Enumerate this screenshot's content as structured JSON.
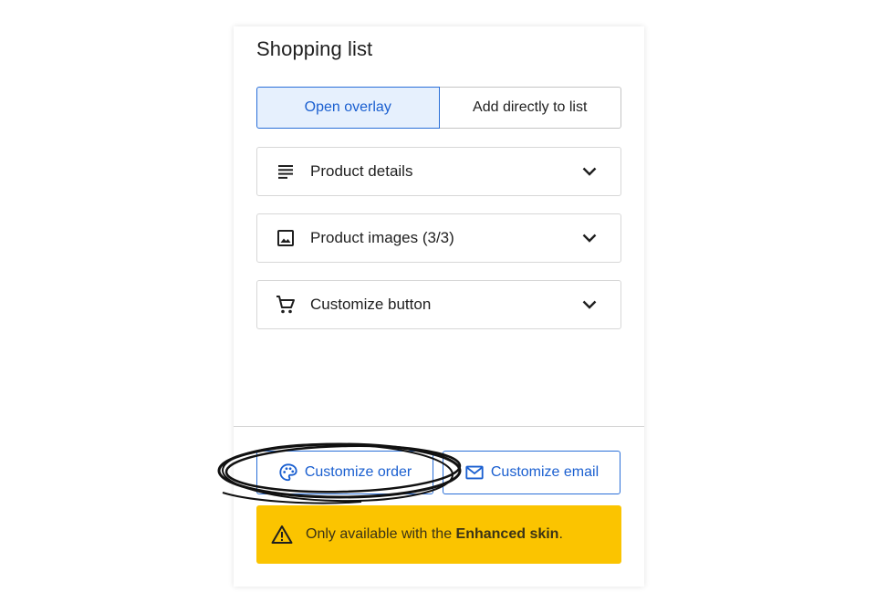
{
  "panel": {
    "title": "Shopping list"
  },
  "mode_toggle": {
    "options": [
      "Open overlay",
      "Add directly to list"
    ],
    "selected": "Open overlay"
  },
  "sections": [
    {
      "label": "Product details",
      "icon": "text-lines-icon"
    },
    {
      "label": "Product images (3/3)",
      "icon": "image-icon"
    },
    {
      "label": "Customize button",
      "icon": "cart-icon"
    }
  ],
  "actions": {
    "customize_order_label": "Customize order",
    "customize_order_icon": "palette-icon",
    "customize_email_label": "Customize email",
    "customize_email_icon": "mail-icon"
  },
  "warning": {
    "prefix": "Only available with the ",
    "emphasis": "Enhanced skin",
    "suffix": ".",
    "icon": "warning-triangle-icon"
  },
  "colors": {
    "accent": "#1a5fd0",
    "selected_bg": "#e6f0fd",
    "warning_bg": "#fbc400"
  }
}
